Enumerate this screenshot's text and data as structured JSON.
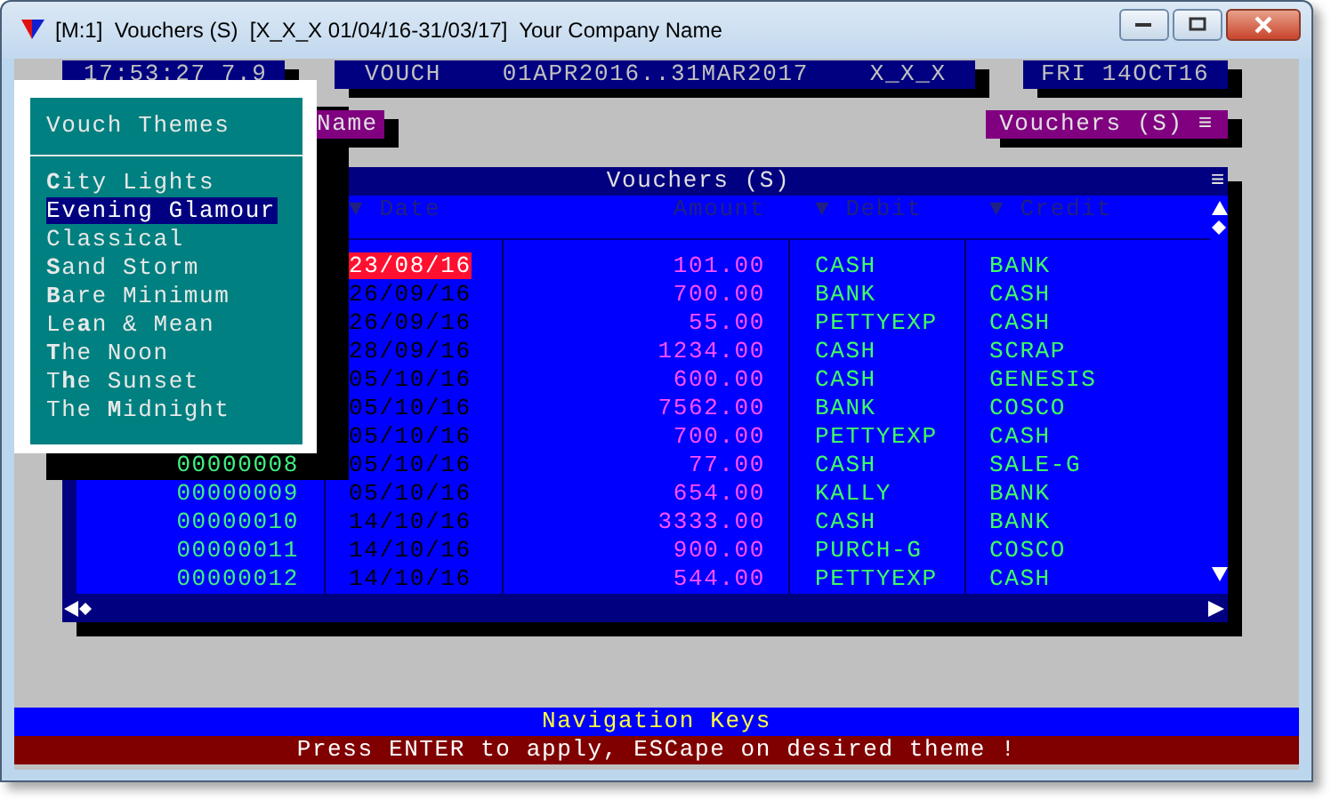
{
  "window": {
    "title": "[M:1]  Vouchers (S)  [X_X_X 01/04/16-31/03/17]  Your Company Name"
  },
  "top_bar": {
    "clock": "17:53:27 7.9",
    "period": "VOUCH    01APR2016..31MAR2017    X_X_X",
    "date": "FRI 14OCT16"
  },
  "field_label": "Name",
  "panel_tag": "Vouchers (S) ≡",
  "table": {
    "title": "Vouchers (S)",
    "menu": "≡",
    "columns": [
      "▼ Date",
      "Amount",
      "▼ Debit",
      "▼ Credit"
    ],
    "rows": [
      {
        "date": "23/08/16",
        "amount": "101.00",
        "debit": "CASH",
        "credit": "BANK",
        "selected": true
      },
      {
        "date": "26/09/16",
        "amount": "700.00",
        "debit": "BANK",
        "credit": "CASH",
        "selected": false
      },
      {
        "date": "26/09/16",
        "amount": "55.00",
        "debit": "PETTYEXP",
        "credit": "CASH",
        "selected": false
      },
      {
        "date": "28/09/16",
        "amount": "1234.00",
        "debit": "CASH",
        "credit": "SCRAP",
        "selected": false
      },
      {
        "date": "05/10/16",
        "amount": "600.00",
        "debit": "CASH",
        "credit": "GENESIS",
        "selected": false
      },
      {
        "date": "05/10/16",
        "amount": "7562.00",
        "debit": "BANK",
        "credit": "COSCO",
        "selected": false
      },
      {
        "date": "05/10/16",
        "amount": "700.00",
        "debit": "PETTYEXP",
        "credit": "CASH",
        "selected": false
      },
      {
        "number": "00000008",
        "date": "05/10/16",
        "amount": "77.00",
        "debit": "CASH",
        "credit": "SALE-G",
        "selected": false
      },
      {
        "number": "00000009",
        "date": "05/10/16",
        "amount": "654.00",
        "debit": "KALLY",
        "credit": "BANK",
        "selected": false
      },
      {
        "number": "00000010",
        "date": "14/10/16",
        "amount": "3333.00",
        "debit": "CASH",
        "credit": "BANK",
        "selected": false
      },
      {
        "number": "00000011",
        "date": "14/10/16",
        "amount": "900.00",
        "debit": "PURCH-G",
        "credit": "COSCO",
        "selected": false
      },
      {
        "number": "00000012",
        "date": "14/10/16",
        "amount": "544.00",
        "debit": "PETTYEXP",
        "credit": "CASH",
        "selected": false
      }
    ]
  },
  "themes": {
    "title": "Vouch Themes",
    "items": [
      {
        "label": "**C**ity Lights",
        "selected": false
      },
      {
        "label": "Evening Glamour",
        "selected": true
      },
      {
        "label": "Classical",
        "selected": false
      },
      {
        "label": "**S**and Storm",
        "selected": false
      },
      {
        "label": "**B**are Minimum",
        "selected": false
      },
      {
        "label": "Le**a**n & Mean",
        "selected": false
      },
      {
        "label": "**T**he Noon",
        "selected": false
      },
      {
        "label": "T**h**e Sunset",
        "selected": false
      },
      {
        "label": "The **M**idnight",
        "selected": false
      }
    ]
  },
  "status": {
    "hint": "Navigation Keys",
    "message": "Press ENTER to apply, ESCape on desired theme !"
  }
}
